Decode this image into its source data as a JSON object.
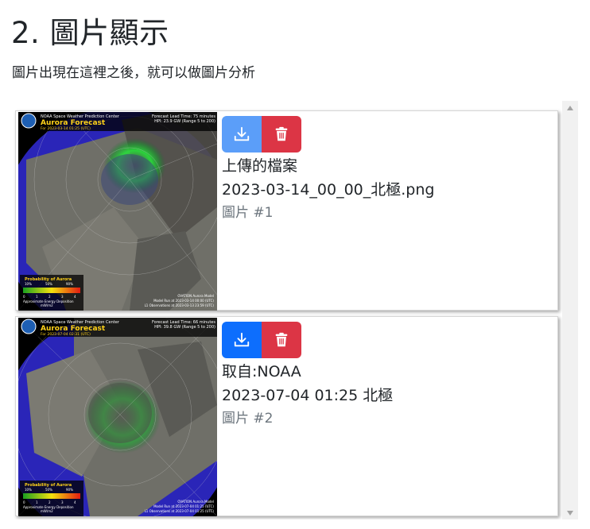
{
  "page": {
    "title": "2. 圖片顯示",
    "subtitle": "圖片出現在這裡之後，就可以做圖片分析"
  },
  "icons": {
    "download": "download-icon",
    "delete": "trash-icon",
    "scroll_up": "arrow-up-icon",
    "scroll_down": "arrow-down-icon"
  },
  "colors": {
    "download_button": "#0d6efd",
    "download_button_faded": "#5b9ef9",
    "delete_button": "#dc3545",
    "caption_muted": "#6c757d"
  },
  "images": [
    {
      "caption": "上傳的檔案",
      "filename": "2023-03-14_00_00_北極.png",
      "label": "圖片 #1",
      "map": {
        "center": "NOAA Space Weather Prediction Center",
        "title": "Aurora Forecast",
        "date": "For 2023-03-14 01:25 (UTC)",
        "lead_time": "Forecast Lead Time:  75 minutes",
        "hpi": "HPI:  23.9 GW (Range 5 to 200)",
        "legend_title": "Probability of Aurora",
        "legend_ticks": [
          "10%",
          "50%",
          "90%"
        ],
        "energy_label": "Approximate Energy Deposition",
        "energy_units": "mW/m2",
        "energy_scale": [
          "0",
          "1",
          "2",
          "3",
          "4"
        ],
        "model": "OVATION Aurora Model",
        "model_run": "Model Run at 2023-03-14 00:00 (UTC)",
        "l1_obs": "L1 Observations at 2023-03-13 23:59 (UTC)"
      }
    },
    {
      "caption": "取自:NOAA",
      "filename": "2023-07-04 01:25 北極",
      "label": "圖片 #2",
      "map": {
        "center": "NOAA Space Weather Prediction Center",
        "title": "Aurora Forecast",
        "date": "For 2023-07-04 02:31 (UTC)",
        "lead_time": "Forecast Lead Time:  66 minutes",
        "hpi": "HPI:  39.8 GW (Range 5 to 200)",
        "legend_title": "Probability of Aurora",
        "legend_ticks": [
          "10%",
          "50%",
          "90%"
        ],
        "energy_label": "Approximate Energy Deposition",
        "energy_units": "mW/m2",
        "energy_scale": [
          "0",
          "1",
          "2",
          "3",
          "4"
        ],
        "model": "OVATION Aurora Model",
        "model_run": "Model Run at 2023-07-04 01:25 (UTC)",
        "l1_obs": "L1 Observations at 2023-07-04 01:25 (UTC)"
      }
    }
  ]
}
